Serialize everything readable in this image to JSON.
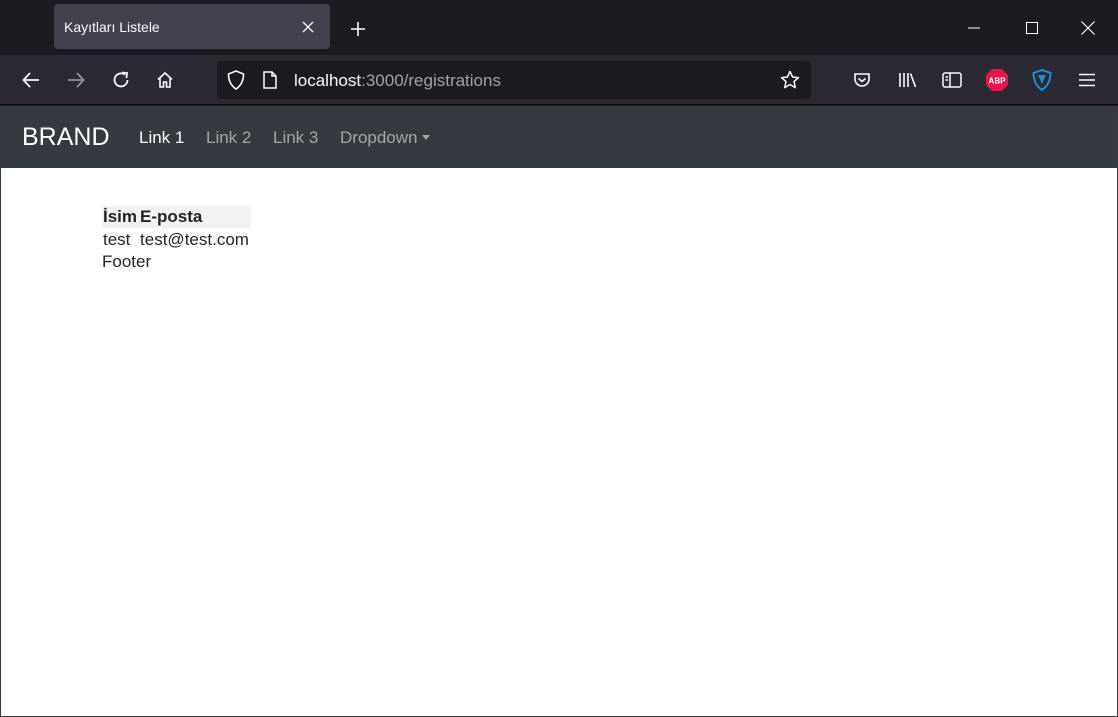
{
  "browser": {
    "tab_title": "Kayıtları Listele",
    "url_host": "localhost",
    "url_path": ":3000/registrations"
  },
  "navbar": {
    "brand": "BRAND",
    "links": [
      {
        "label": "Link 1",
        "active": true
      },
      {
        "label": "Link 2",
        "active": false
      },
      {
        "label": "Link 3",
        "active": false
      },
      {
        "label": "Dropdown",
        "active": false
      }
    ]
  },
  "table": {
    "headers": [
      "İsim",
      "E-posta"
    ],
    "rows": [
      [
        "test",
        "test@test.com"
      ]
    ]
  },
  "footer": "Footer",
  "icons": {
    "abp_badge": "ABP",
    "abp_color": "#e8174b",
    "shield_color": "#1a8fd8"
  }
}
